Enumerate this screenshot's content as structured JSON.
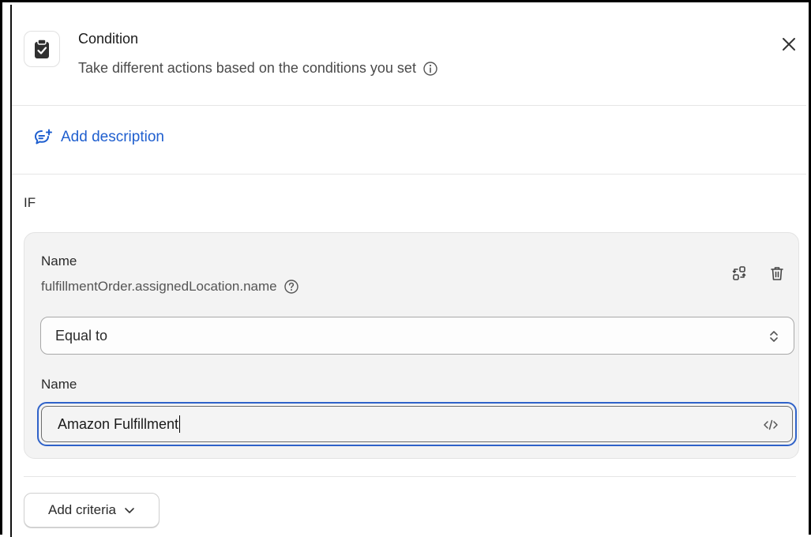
{
  "header": {
    "title": "Condition",
    "subtitle": "Take different actions based on the conditions you set",
    "icon": "clipboard-check-icon"
  },
  "description": {
    "link_label": "Add description"
  },
  "if_label": "IF",
  "criteria": {
    "field_label": "Name",
    "field_path": "fulfillmentOrder.assignedLocation.name",
    "operator": "Equal to",
    "value_label": "Name",
    "value": "Amazon Fulfillment"
  },
  "footer": {
    "add_criteria_label": "Add criteria"
  },
  "colors": {
    "link": "#1f5fcf",
    "focus": "#2f62c9",
    "card_bg": "#f3f3f3"
  }
}
